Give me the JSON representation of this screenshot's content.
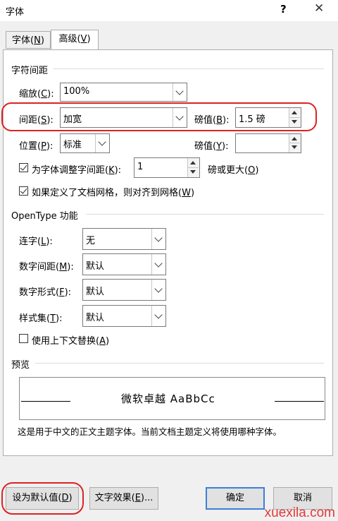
{
  "window": {
    "title": "字体",
    "help": "?",
    "close": "✕"
  },
  "tabs": [
    {
      "label": "字体(N)",
      "key": "N",
      "pre": "字体(",
      "post": ")"
    },
    {
      "label": "高级(V)",
      "key": "V",
      "pre": "高级(",
      "post": ")"
    }
  ],
  "spacing_group": {
    "title": "字符间距",
    "scale": {
      "pre": "缩放(",
      "key": "C",
      "post": "):",
      "value": "100%"
    },
    "spacing": {
      "pre": "间距(",
      "key": "S",
      "post": "):",
      "value": "加宽"
    },
    "spacing_by": {
      "pre": "磅值(",
      "key": "B",
      "post": "):",
      "value": "1.5 磅"
    },
    "position": {
      "pre": "位置(",
      "key": "P",
      "post": "):",
      "value": "标准"
    },
    "position_by": {
      "pre": "磅值(",
      "key": "Y",
      "post": "):",
      "value": ""
    },
    "kerning": {
      "pre": "为字体调整字间距(",
      "key": "K",
      "post": "):",
      "value": "1",
      "checked": true,
      "suffix_pre": "磅或更大(",
      "suffix_key": "O",
      "suffix_post": ")"
    },
    "snap": {
      "pre": "如果定义了文档网格，则对齐到网格(",
      "key": "W",
      "post": ")",
      "checked": true
    }
  },
  "opentype_group": {
    "title": "OpenType 功能",
    "ligatures": {
      "pre": "连字(",
      "key": "L",
      "post": "):",
      "value": "无"
    },
    "num_spacing": {
      "pre": "数字间距(",
      "key": "M",
      "post": "):",
      "value": "默认"
    },
    "num_forms": {
      "pre": "数字形式(",
      "key": "F",
      "post": "):",
      "value": "默认"
    },
    "stylistic": {
      "pre": "样式集(",
      "key": "T",
      "post": "):",
      "value": "默认"
    },
    "contextual": {
      "pre": "使用上下文替换(",
      "key": "A",
      "post": ")",
      "checked": false
    }
  },
  "preview": {
    "title": "预览",
    "sample": "微软卓越  AaBbCc",
    "description": "这是用于中文的正文主题字体。当前文档主题定义将使用哪种字体。"
  },
  "buttons": {
    "set_default": {
      "pre": "设为默认值(",
      "key": "D",
      "post": ")"
    },
    "text_effects": {
      "pre": "文字效果(",
      "key": "E",
      "post": ")..."
    },
    "ok": "确定",
    "cancel": "取消"
  },
  "watermark": "xuexila.com",
  "colors": {
    "highlight": "#dd2222",
    "primary_border": "#3c7fd9",
    "watermark": "#e23a3a"
  }
}
